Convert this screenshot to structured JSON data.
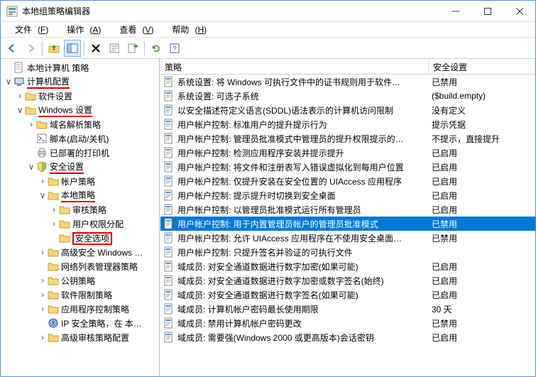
{
  "window": {
    "title": "本地组策略编辑器"
  },
  "menubar": [
    {
      "label": "文件",
      "key": "F"
    },
    {
      "label": "操作",
      "key": "A"
    },
    {
      "label": "查看",
      "key": "V"
    },
    {
      "label": "帮助",
      "key": "H"
    }
  ],
  "tree": {
    "root": "本地计算机 策略",
    "cc": "计算机配置",
    "soft": "软件设置",
    "win": "Windows 设置",
    "dns": "域名解析策略",
    "script": "脚本(启动/关机)",
    "printer": "已部署的打印机",
    "sec": "安全设置",
    "acct": "帐户策略",
    "local": "本地策略",
    "audit": "审核策略",
    "rights": "用户权限分配",
    "secopt": "安全选项",
    "fw": "高级安全 Windows …",
    "netlist": "网络列表管理器策略",
    "pubkey": "公钥策略",
    "softrestr": "软件限制策略",
    "appctrl": "应用程序控制策略",
    "ipsec": "IP 安全策略，在 本…",
    "advaudit": "高级审核策略配置"
  },
  "list": {
    "cols": {
      "policy": "策略",
      "setting": "安全设置"
    },
    "rows": [
      {
        "p": "系统设置: 将 Windows 可执行文件中的证书规则用于软件…",
        "s": "已禁用"
      },
      {
        "p": "系统设置: 可选子系统",
        "s": "($build.empty)"
      },
      {
        "p": "以安全描述符定义语言(SDDL)语法表示的计算机访问限制",
        "s": "没有定义"
      },
      {
        "p": "用户帐户控制: 标准用户的提升提示行为",
        "s": "提示凭据"
      },
      {
        "p": "用户帐户控制: 管理员批准模式中管理员的提升权限提示的…",
        "s": "不提示，直接提升"
      },
      {
        "p": "用户帐户控制: 检测应用程序安装并提示提升",
        "s": "已启用"
      },
      {
        "p": "用户帐户控制: 将文件和注册表写入错误虚拟化到每用户位置",
        "s": "已启用"
      },
      {
        "p": "用户帐户控制: 仅提升安装在安全位置的 UIAccess 应用程序",
        "s": "已启用"
      },
      {
        "p": "用户帐户控制: 提示提升时切换到安全桌面",
        "s": "已启用"
      },
      {
        "p": "用户帐户控制: 以管理员批准模式运行所有管理员",
        "s": "已启用"
      },
      {
        "p": "用户帐户控制: 用于内置管理员帐户的管理员批准模式",
        "s": "已禁用",
        "sel": true
      },
      {
        "p": "用户帐户控制: 允许 UIAccess 应用程序在不使用安全桌面…",
        "s": "已禁用"
      },
      {
        "p": "用户帐户控制: 只提升签名并验证的可执行文件",
        "s": ""
      },
      {
        "p": "域成员: 对安全通道数据进行数字加密(如果可能)",
        "s": "已启用"
      },
      {
        "p": "域成员: 对安全通道数据进行数字加密或数字签名(始终)",
        "s": "已启用"
      },
      {
        "p": "域成员: 对安全通道数据进行数字签名(如果可能)",
        "s": "已启用"
      },
      {
        "p": "域成员: 计算机帐户密码最长使用期限",
        "s": "30 天"
      },
      {
        "p": "域成员: 禁用计算机帐户密码更改",
        "s": "已禁用"
      },
      {
        "p": "域成员: 需要强(Windows 2000 或更高版本)会话密钥",
        "s": "已启用"
      }
    ]
  }
}
